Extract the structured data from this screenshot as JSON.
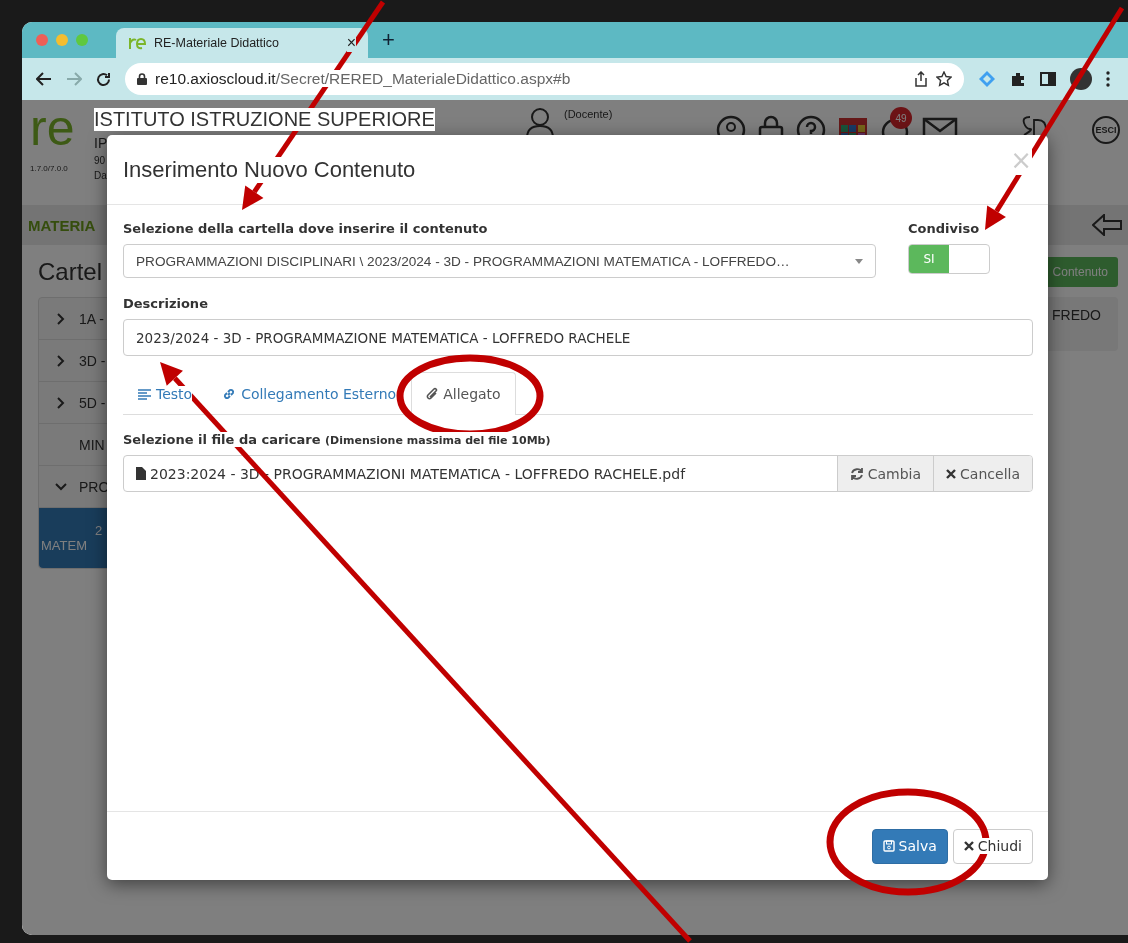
{
  "browser": {
    "tab_title": "RE-Materiale Didattico",
    "tab_close": "×",
    "new_tab": "+",
    "url_host": "re10.axioscloud.it",
    "url_path": "/Secret/RERED_MaterialeDidattico.aspx#b"
  },
  "page": {
    "logo": "re",
    "school": "ISTITUTO ISTRUZIONE SUPERIORE",
    "school_line_2": "IP",
    "version": "1.7.0/7.0.0",
    "line_3": "90",
    "line_4": "Da",
    "role": "(Docente)",
    "notification_count": "49",
    "logout": "ESCI",
    "section_title": "MATERIA",
    "heading": "Cartel",
    "add_button": "Contenuto",
    "side_text": "FREDO",
    "folders": [
      {
        "kind": "folder",
        "label": "1A -",
        "expanded": false,
        "selected": false
      },
      {
        "kind": "folder",
        "label": "3D -",
        "expanded": false,
        "selected": false
      },
      {
        "kind": "folder",
        "label": "5D -",
        "expanded": false,
        "selected": false
      },
      {
        "kind": "leaf",
        "label": "MIN",
        "selected": false
      },
      {
        "kind": "folder",
        "label": "PRO",
        "expanded": true,
        "selected": false,
        "children": [
          {
            "kind": "leaf",
            "label": "2",
            "label_2": "MATEM",
            "selected": true
          }
        ]
      }
    ]
  },
  "modal": {
    "title": "Inserimento Nuovo Contenuto",
    "close": "×",
    "folder_label": "Selezione della cartella dove inserire il contenuto",
    "folder_value": "PROGRAMMAZIONI DISCIPLINARI \\ 2023/2024 - 3D - PROGRAMMAZIONI MATEMATICA - LOFFREDO…",
    "shared_label": "Condiviso",
    "shared": {
      "label": "SI",
      "on": true
    },
    "description_label": "Descrizione",
    "description_value": "2023/2024 - 3D - PROGRAMMAZIONE MATEMATICA - LOFFREDO RACHELE",
    "tabs": [
      {
        "kind": "text",
        "label": "Testo",
        "selected": false
      },
      {
        "kind": "link",
        "label": "Collegamento Esterno",
        "selected": false
      },
      {
        "kind": "attachment",
        "label": "Allegato",
        "selected": true
      }
    ],
    "file_label": "Selezione il file da caricare",
    "file_hint": "(Dimensione massima del file 10Mb)",
    "file_name": "2023:2024 - 3D - PROGRAMMAZIONI MATEMATICA - LOFFREDO RACHELE.pdf",
    "change_button": "Cambia",
    "remove_button": "Cancella",
    "save_button": "Salva",
    "close_button": "Chiudi"
  }
}
